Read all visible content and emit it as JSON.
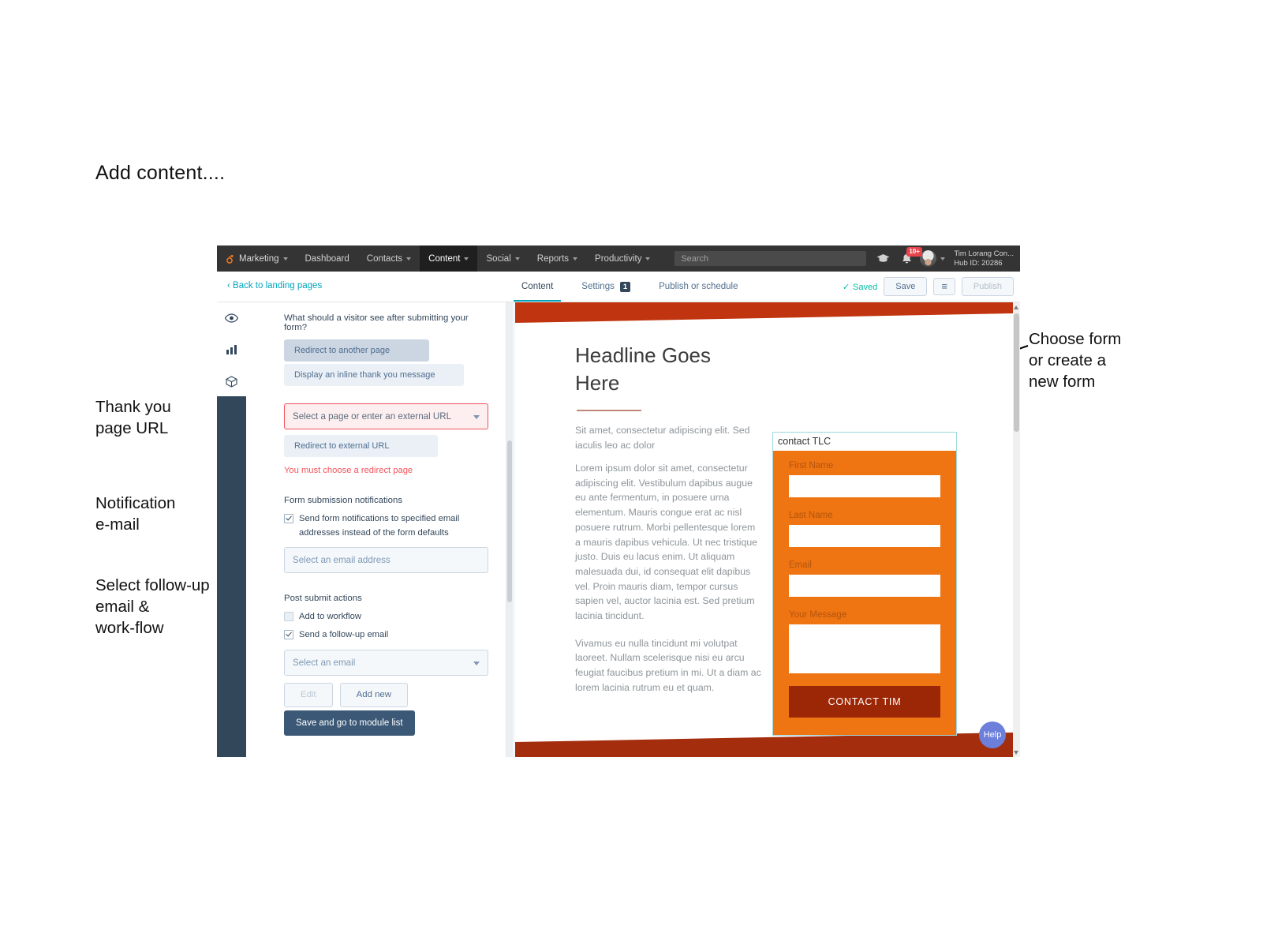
{
  "slide": {
    "title": "Add content....",
    "annotations": {
      "thank_you": "Thank you\npage URL",
      "notification": "Notification\ne-mail",
      "followup": "Select follow-up\nemail &\nwork-flow",
      "choose_form": "Choose form\nor create a\nnew form"
    }
  },
  "app": {
    "topnav": {
      "brand": "Marketing",
      "items": [
        {
          "label": "Marketing",
          "caret": true,
          "active": false
        },
        {
          "label": "Dashboard",
          "caret": false,
          "active": false
        },
        {
          "label": "Contacts",
          "caret": true,
          "active": false
        },
        {
          "label": "Content",
          "caret": true,
          "active": true
        },
        {
          "label": "Social",
          "caret": true,
          "active": false
        },
        {
          "label": "Reports",
          "caret": true,
          "active": false
        },
        {
          "label": "Productivity",
          "caret": true,
          "active": false
        }
      ],
      "search_placeholder": "Search",
      "notification_badge": "10+",
      "user_name": "Tim Lorang Con...",
      "hub_id": "Hub ID: 20286"
    },
    "toolbar": {
      "back_link": "‹ Back to landing pages",
      "tabs": [
        {
          "label": "Content",
          "active": true,
          "badge": ""
        },
        {
          "label": "Settings",
          "active": false,
          "badge": "1"
        },
        {
          "label": "Publish or schedule",
          "active": false,
          "badge": ""
        }
      ],
      "saved_state": "Saved",
      "save_label": "Save",
      "menu_icon": "≡",
      "publish_label": "Publish"
    },
    "panel": {
      "question": "What should a visitor see after submitting your form?",
      "option_redirect_page": "Redirect to another page",
      "option_inline_thankyou": "Display an inline thank you message",
      "redirect_select_placeholder": "Select a page or enter an external URL",
      "option_external_url": "Redirect to external URL",
      "error_text": "You must choose a redirect page",
      "notifications_heading": "Form submission notifications",
      "notifications_checkbox": "Send form notifications to specified email addresses instead of the form defaults",
      "email_address_placeholder": "Select an email address",
      "post_submit_heading": "Post submit actions",
      "add_to_workflow": "Add to workflow",
      "send_followup_email": "Send a follow-up email",
      "select_email_placeholder": "Select an email",
      "edit_label": "Edit",
      "add_new_label": "Add new",
      "save_module_list_label": "Save and go to module list"
    },
    "preview": {
      "headline": "Headline Goes Here",
      "subhead": "Sit amet, consectetur adipiscing elit. Sed iaculis leo ac dolor",
      "paragraph1": "Lorem ipsum dolor sit amet, consectetur adipiscing elit. Vestibulum dapibus augue eu ante fermentum, in posuere urna elementum. Mauris congue erat ac nisl posuere rutrum. Morbi pellentesque lorem a mauris dapibus vehicula. Ut nec tristique justo. Duis eu lacus enim. Ut aliquam malesuada dui, id consequat elit dapibus vel. Proin mauris diam, tempor cursus sapien vel, auctor lacinia est. Sed pretium lacinia tincidunt.",
      "paragraph2": "Vivamus eu nulla tincidunt mi volutpat laoreet. Nullam scelerisque nisi eu arcu feugiat faucibus pretium in mi. Ut a diam ac lorem lacinia rutrum eu et quam.",
      "form": {
        "title": "contact TLC",
        "fields": [
          {
            "label": "First Name",
            "type": "text"
          },
          {
            "label": "Last Name",
            "type": "text"
          },
          {
            "label": "Email",
            "type": "text"
          },
          {
            "label": "Your Message",
            "type": "textarea"
          }
        ],
        "submit_label": "CONTACT TIM"
      },
      "help_label": "Help"
    },
    "colors": {
      "accent_teal": "#00a4bd",
      "error_red": "#f2545b",
      "form_orange": "#ef7412",
      "form_submit_red": "#9c2706",
      "hero_red": "#c0350f",
      "panel_dark": "#33475b"
    }
  }
}
